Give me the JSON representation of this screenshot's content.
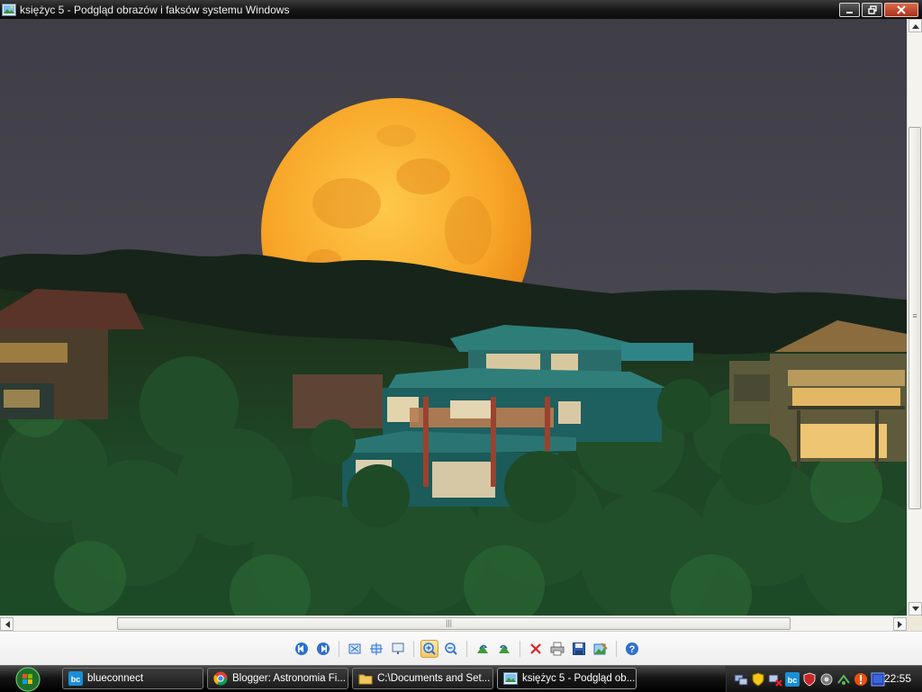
{
  "window": {
    "title": "księżyc 5 - Podgląd obrazów i faksów systemu Windows",
    "icon": "image-viewer-icon"
  },
  "image": {
    "description_icon": "photo-moonrise",
    "colors": {
      "sky": "#44434b",
      "moon": "#f3a52a",
      "forest": "#1d3f21",
      "house": "#2b7a78"
    }
  },
  "scrollbars": {
    "vertical": {
      "position": 0.18,
      "grip": "≡"
    },
    "horizontal": {
      "position": 0.15,
      "grip": "|||"
    }
  },
  "toolbar": {
    "buttons": [
      {
        "name": "previous-image-button",
        "icon": "previous-icon"
      },
      {
        "name": "next-image-button",
        "icon": "next-icon"
      },
      {
        "sep": true
      },
      {
        "name": "best-fit-button",
        "icon": "best-fit-icon"
      },
      {
        "name": "actual-size-button",
        "icon": "actual-size-icon"
      },
      {
        "name": "slideshow-button",
        "icon": "slideshow-icon"
      },
      {
        "sep": true
      },
      {
        "name": "zoom-in-button",
        "icon": "zoom-in-icon",
        "active": true
      },
      {
        "name": "zoom-out-button",
        "icon": "zoom-out-icon"
      },
      {
        "sep": true
      },
      {
        "name": "rotate-clockwise-button",
        "icon": "rotate-cw-icon"
      },
      {
        "name": "rotate-counterclockwise-button",
        "icon": "rotate-ccw-icon"
      },
      {
        "sep": true
      },
      {
        "name": "delete-button",
        "icon": "delete-icon"
      },
      {
        "name": "print-button",
        "icon": "print-icon"
      },
      {
        "name": "save-button",
        "icon": "save-icon"
      },
      {
        "name": "open-for-editing-button",
        "icon": "edit-icon"
      },
      {
        "sep": true
      },
      {
        "name": "help-button",
        "icon": "help-icon"
      }
    ]
  },
  "taskbar": {
    "tasks": [
      {
        "label": "blueconnect",
        "icon": "blueconnect-icon"
      },
      {
        "label": "Blogger: Astronomia Fi...",
        "icon": "chrome-icon"
      },
      {
        "label": "C:\\Documents and Set...",
        "icon": "folder-icon"
      },
      {
        "label": "księżyc 5 - Podgląd ob...",
        "icon": "image-viewer-icon",
        "active": true
      }
    ],
    "tray_icons": [
      "network-icon",
      "security-shield-icon",
      "network-disconnected-icon",
      "blueconnect-tray-icon",
      "antivirus-icon",
      "sound-icon",
      "wifi-icon",
      "alert-icon",
      "monitor-icon"
    ],
    "clock": "22:55"
  }
}
